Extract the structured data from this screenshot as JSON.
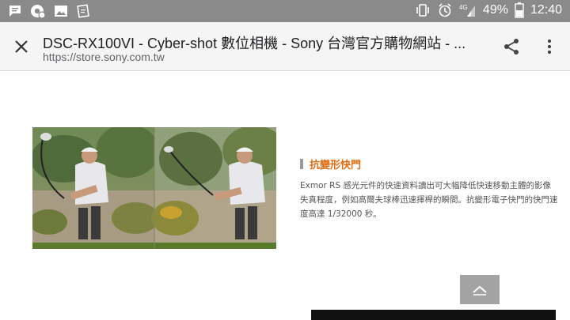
{
  "status_bar": {
    "battery": "49%",
    "time": "12:40",
    "network": "4G",
    "icons": [
      "message-icon",
      "chrome-notification-icon",
      "image-icon",
      "clipboard-icon",
      "vibrate-icon",
      "alarm-icon",
      "signal-icon",
      "battery-icon"
    ]
  },
  "toolbar": {
    "title": "DSC-RX100VI - Cyber-shot 數位相機 - Sony 台灣官方購物網站 - ...",
    "url": "https://store.sony.com.tw",
    "close_icon": "close-icon",
    "share_icon": "share-icon",
    "more_icon": "more-vert-icon"
  },
  "feature": {
    "title": "抗變形快門",
    "description": "Exmor RS 感光元件的快速資料讀出可大幅降低快速移動主體的影像失真程度，例如高爾夫球棒迅速揮桿的瞬間。抗變形電子快門的快門速度高達 1/32000 秒。"
  },
  "colors": {
    "status_bar": "#8a8a8a",
    "toolbar": "#f5f5f5",
    "accent": "#e06e12",
    "back_to_top": "#a3a3a3"
  }
}
